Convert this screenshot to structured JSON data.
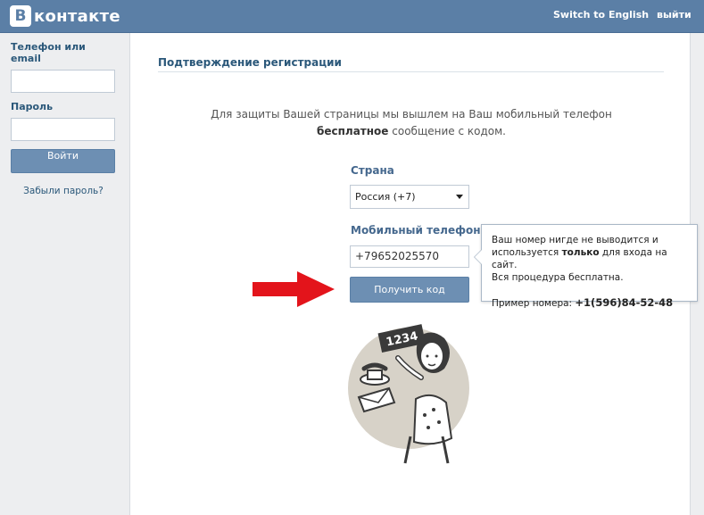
{
  "header": {
    "logo_letter": "В",
    "logo_text": "контакте",
    "switch_lang": "Switch to English",
    "logout": "выйти",
    "bg_color": "#5b7fa6"
  },
  "login": {
    "phone_label": "Телефон или email",
    "password_label": "Пароль",
    "login_button": "Войти",
    "forgot": "Забыли пароль?"
  },
  "main": {
    "title": "Подтверждение регистрации",
    "intro_before": "Для защиты Вашей страницы мы вышлем на Ваш мобильный телефон",
    "intro_bold": "бесплатное",
    "intro_after": "сообщение с кодом.",
    "country_label": "Страна",
    "country_value": "Россия (+7)",
    "phone_label": "Мобильный телефон",
    "phone_value": "+79652025570",
    "get_code_button": "Получить код"
  },
  "tooltip": {
    "line1": "Ваш номер нигде не выводится и",
    "line2_before": "используется ",
    "line2_bold": "только",
    "line2_after": " для входа на сайт.",
    "line3": "Вся процедура бесплатна.",
    "example_label": "Пример номера: ",
    "example_number": "+1(596)84-52-48"
  },
  "illustration": {
    "sign_text": "1234",
    "icon": "woman-with-phone-illustration"
  },
  "arrow": {
    "icon": "red-arrow-icon",
    "color": "#e3141b"
  }
}
